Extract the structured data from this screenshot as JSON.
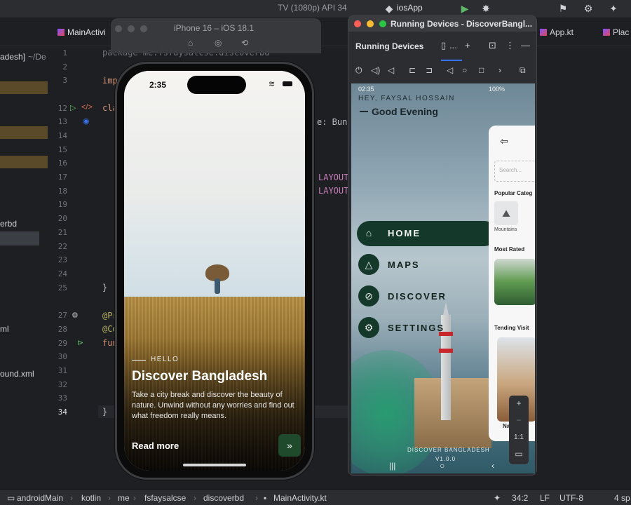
{
  "topbar": {
    "run_config": "TV (1080p) API 34",
    "app_target": "iosApp"
  },
  "tabs": [
    {
      "label": "MainActivi"
    },
    {
      "label": "App.kt"
    },
    {
      "label": "Plac"
    }
  ],
  "project": {
    "items": [
      "adesh]",
      "~/De",
      "erbd",
      "ml",
      "ound.xml"
    ]
  },
  "gutter": {
    "lines": [
      "1",
      "2",
      "3",
      "12",
      "13",
      "14",
      "15",
      "16",
      "17",
      "18",
      "19",
      "20",
      "21",
      "22",
      "23",
      "24",
      "25",
      "26",
      "27",
      "28",
      "29",
      "30",
      "31",
      "32",
      "33",
      "34"
    ]
  },
  "code": {
    "l1": "package me.fsfaysalcse.discoverbd",
    "l3": "imp",
    "l12": "cla",
    "bund": "e: Bund",
    "layout1": "LAYOUT",
    "layout2": "LAYOUT",
    "brace1": "}",
    "p1": "@Pr",
    "p2": "@Co",
    "p3": "fun",
    "brace2": "}"
  },
  "simulator": {
    "title": "iPhone 16 – iOS 18.1"
  },
  "ios_app": {
    "time": "2:35",
    "hello": "HELLO",
    "headline": "Discover Bangladesh",
    "description": "Take a city break and discover the beauty of nature. Unwind without any worries and find out what freedom really means.",
    "read_more": "Read more",
    "arrow": "»"
  },
  "running_devices": {
    "window_title": "Running Devices - DiscoverBangl...",
    "panel_label": "Running Devices",
    "device_tab": "..."
  },
  "android_app": {
    "status_time": "02:35",
    "battery": "100%",
    "greeting_small": "HEY, FAYSAL HOSSAIN",
    "greeting": "Good Evening",
    "menu": [
      {
        "label": "HOME",
        "icon": "⌂"
      },
      {
        "label": "MAPS",
        "icon": "△"
      },
      {
        "label": "DISCOVER",
        "icon": "⊘"
      },
      {
        "label": "SETTINGS",
        "icon": "⚙"
      }
    ],
    "footer_title": "DISCOVER BANGLADESH",
    "footer_version": "V1.0.0",
    "drawer": {
      "search_placeholder": "Search...",
      "popular": "Popular Categ",
      "mountains": "Mountains",
      "most_rated": "Most Rated",
      "tending": "Tending Visit",
      "card_label": "Na    M"
    },
    "zoom_label": "1:1"
  },
  "statusbar": {
    "path": [
      "androidMain",
      "kotlin",
      "me",
      "fsfaysalcse",
      "discoverbd",
      "MainActivity.kt"
    ],
    "position": "34:2",
    "line_sep": "LF",
    "encoding": "UTF-8",
    "indent": "4 sp"
  },
  "colors": {
    "ide_bg": "#1e1f22",
    "accent": "#3574f0",
    "android_green": "#14382a"
  }
}
